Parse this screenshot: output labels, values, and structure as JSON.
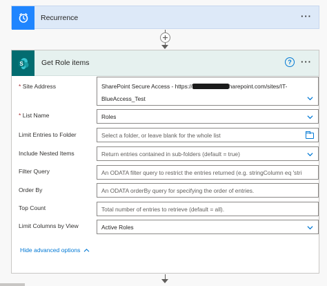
{
  "recurrence": {
    "title": "Recurrence",
    "menu_label": "···"
  },
  "action": {
    "title": "Get Role items",
    "help_label": "?",
    "menu_label": "···",
    "required_marker": "*",
    "fields": {
      "site_address": {
        "label": "Site Address",
        "value_prefix": "SharePoint Secure Access - https://",
        "value_suffix": "harepoint.com/sites/IT-",
        "value_line2": "BlueAccess_Test"
      },
      "list_name": {
        "label": "List Name",
        "value": "Roles"
      },
      "limit_folder": {
        "label": "Limit Entries to Folder",
        "placeholder": "Select a folder, or leave blank for the whole list"
      },
      "nested_items": {
        "label": "Include Nested Items",
        "value": "Return entries contained in sub-folders (default = true)"
      },
      "filter_query": {
        "label": "Filter Query",
        "placeholder": "An ODATA filter query to restrict the entries returned (e.g. stringColumn eq 'stri"
      },
      "order_by": {
        "label": "Order By",
        "placeholder": "An ODATA orderBy query for specifying the order of entries."
      },
      "top_count": {
        "label": "Top Count",
        "placeholder": "Total number of entries to retrieve (default = all)."
      },
      "limit_columns": {
        "label": "Limit Columns by View",
        "value": "Active Roles"
      }
    },
    "advanced_link": "Hide advanced options"
  },
  "colors": {
    "recurrence_accent": "#1f85ff",
    "sharepoint_accent": "#036c70",
    "link": "#0078d4",
    "required": "#a4262c"
  },
  "icons": [
    "clock-icon",
    "sharepoint-icon",
    "help-icon",
    "chevron-down-icon",
    "folder-icon",
    "chevron-up-icon",
    "plus-icon",
    "arrow-down-icon"
  ]
}
